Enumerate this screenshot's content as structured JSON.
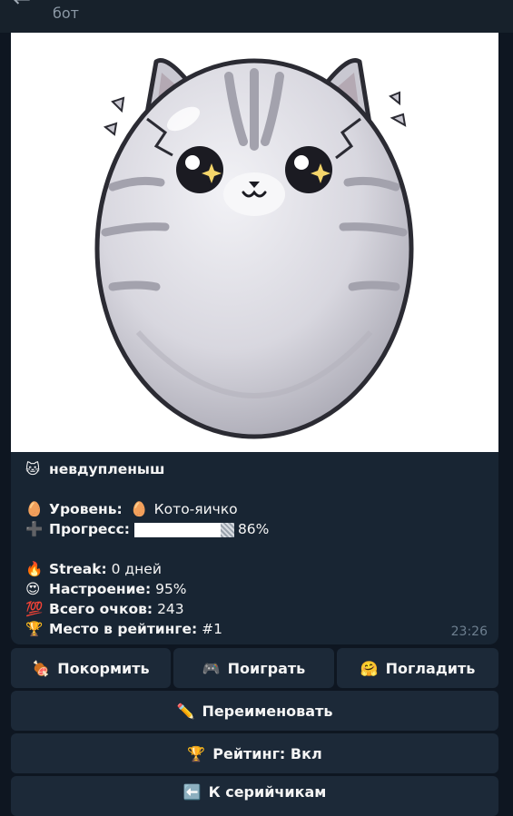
{
  "header": {
    "subtitle": "бот",
    "back_icon": "arrow-left-icon"
  },
  "message": {
    "name_emoji": "🐱",
    "name": "невдупленыш",
    "level_emoji": "🥚",
    "level_label": "Уровень:",
    "level_value_emoji": "🥚",
    "level_value": "Кото-яичко",
    "progress_emoji": "➕",
    "progress_label": "Прогресс:",
    "progress_fraction": 0.86,
    "progress_percent": "86%",
    "streak_emoji": "🔥",
    "streak_label": "Streak:",
    "streak_value": "0 дней",
    "mood_emoji": "😍",
    "mood_label": "Настроение:",
    "mood_value": "95%",
    "points_emoji": "💯",
    "points_label": "Всего очков:",
    "points_value": "243",
    "rank_emoji": "🏆",
    "rank_label": "Место в рейтинге:",
    "rank_value": "#1",
    "time": "23:26"
  },
  "keyboard": {
    "feed": {
      "emoji": "🍖",
      "label": "Покормить"
    },
    "play": {
      "emoji": "🎮",
      "label": "Поиграть"
    },
    "pet": {
      "emoji": "🤗",
      "label": "Погладить"
    },
    "rename": {
      "emoji": "✏️",
      "label": "Переименовать"
    },
    "rating": {
      "emoji": "🏆",
      "label": "Рейтинг: Вкл"
    },
    "back": {
      "emoji": "⬅️",
      "label": "К серийчикам"
    }
  },
  "colors": {
    "background": "#0e1621",
    "card": "#182533",
    "button": "#1c2938",
    "time": "#6d7f8f"
  }
}
